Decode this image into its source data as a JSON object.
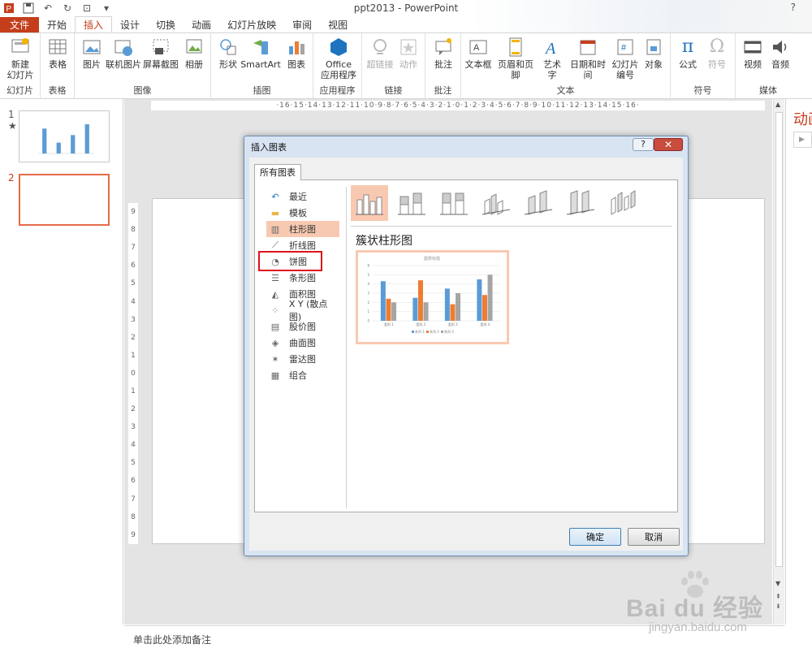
{
  "app": {
    "title": "ppt2013 - PowerPoint",
    "help": "?"
  },
  "qat": [
    "powerpoint-logo-icon",
    "save-icon",
    "undo-icon",
    "redo-icon",
    "start-from-beginning-icon",
    "customize-icon"
  ],
  "tabs": [
    "文件",
    "开始",
    "插入",
    "设计",
    "切换",
    "动画",
    "幻灯片放映",
    "审阅",
    "视图"
  ],
  "active_tab": "插入",
  "ribbon": {
    "groups": {
      "slides": "幻灯片",
      "tables": "表格",
      "images": "图像",
      "illustrations": "插图",
      "apps": "应用程序",
      "links": "链接",
      "comments": "批注",
      "text": "文本",
      "symbols": "符号",
      "media": "媒体"
    },
    "buttons": {
      "new_slide": "新建\n幻灯片",
      "table": "表格",
      "picture": "图片",
      "online_picture": "联机图片",
      "screenshot": "屏幕截图",
      "album": "相册",
      "shapes": "形状",
      "smartart": "SmartArt",
      "chart": "图表",
      "office_apps": "Office\n应用程序",
      "hyperlink": "超链接",
      "action": "动作",
      "comment": "批注",
      "textbox": "文本框",
      "header_footer": "页眉和页脚",
      "wordart": "艺术字",
      "datetime": "日期和时间",
      "slide_number": "幻灯片\n编号",
      "object": "对象",
      "equation": "公式",
      "symbol": "符号",
      "video": "视频",
      "audio": "音频"
    }
  },
  "slides": [
    {
      "number": "1",
      "mark": "★"
    },
    {
      "number": "2"
    }
  ],
  "ruler": {
    "horizontal": "·16·15·14·13·12·11·10·9·8·7·6·5·4·3·2·1·0·1·2·3·4·5·6·7·8·9·10·11·12·13·14·15·16·",
    "vertical": [
      "9",
      "8",
      "7",
      "6",
      "5",
      "4",
      "3",
      "2",
      "1",
      "0",
      "1",
      "2",
      "3",
      "4",
      "5",
      "6",
      "7",
      "8",
      "9"
    ]
  },
  "right_panel": {
    "title": "动画窗格"
  },
  "notes": {
    "placeholder": "单击此处添加备注"
  },
  "watermark": {
    "brand": "Bai du 经验",
    "url": "jingyan.baidu.com"
  },
  "dialog": {
    "title": "插入图表",
    "help": "?",
    "close": "✕",
    "tab": "所有图表",
    "chart_types": [
      "最近",
      "模板",
      "柱形图",
      "折线图",
      "饼图",
      "条形图",
      "面积图",
      "X Y (散点图)",
      "股价图",
      "曲面图",
      "雷达图",
      "组合"
    ],
    "selected_type": "柱形图",
    "highlighted_type": "饼图",
    "subtype_title": "簇状柱形图",
    "ok": "确定",
    "cancel": "取消",
    "colors": {
      "selection": "#f8c9b1",
      "highlight": "#e0121b"
    }
  },
  "preview_chart": {
    "title": "图表标题",
    "categories": [
      "类别 1",
      "类别 2",
      "类别 3",
      "类别 4"
    ],
    "series": [
      {
        "name": "系列 1",
        "color": "#5b9bd5",
        "values": [
          4.3,
          2.5,
          3.5,
          4.5
        ]
      },
      {
        "name": "系列 2",
        "color": "#ed7d31",
        "values": [
          2.4,
          4.4,
          1.8,
          2.8
        ]
      },
      {
        "name": "系列 3",
        "color": "#a5a5a5",
        "values": [
          2,
          2,
          3,
          5
        ]
      }
    ],
    "ylim": [
      0,
      6
    ]
  },
  "thumb_chart": {
    "values": [
      2.3,
      1,
      1.7,
      2.7
    ],
    "ylim": [
      0,
      3
    ],
    "color": "#5b9bd5"
  },
  "colors": {
    "accent": "#c43e1c",
    "file_tab": "#c43e1c"
  }
}
